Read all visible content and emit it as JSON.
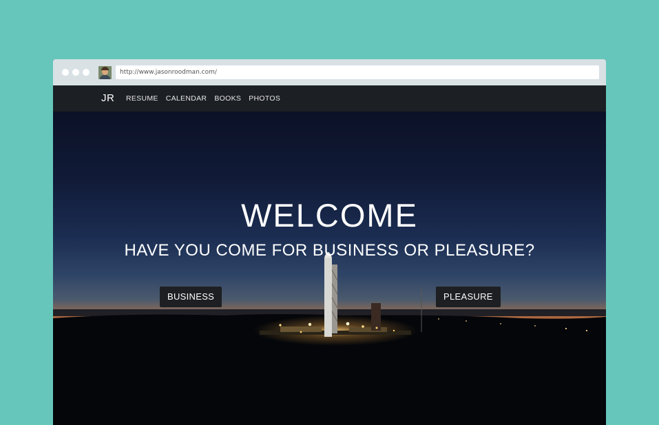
{
  "browser": {
    "url": "http://www.jasonroodman.com/"
  },
  "nav": {
    "brand": "JR",
    "links": [
      "RESUME",
      "CALENDAR",
      "BOOKS",
      "PHOTOS"
    ]
  },
  "hero": {
    "title": "WELCOME",
    "subtitle": "HAVE YOU COME FOR BUSINESS OR PLEASURE?",
    "business_label": "BUSINESS",
    "pleasure_label": "PLEASURE"
  },
  "colors": {
    "page_background": "#66c6bb",
    "navbar": "#1c1f23",
    "button": "#1d1f22",
    "horizon_glow": "#e5741f"
  },
  "icons": [
    "window-close-dot",
    "window-minimize-dot",
    "window-maximize-dot",
    "avatar-favicon",
    "rocket-launch-image"
  ]
}
